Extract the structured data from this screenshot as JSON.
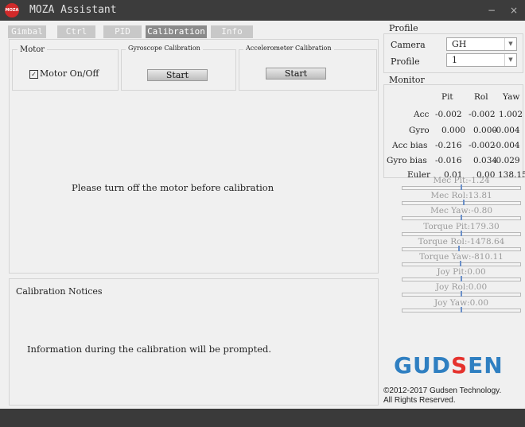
{
  "window": {
    "title": "MOZA Assistant",
    "logo_text": "MOZA",
    "minimize": "−",
    "close": "×"
  },
  "tabs": [
    {
      "label": "Gimbal"
    },
    {
      "label": "Ctrl"
    },
    {
      "label": "PID"
    },
    {
      "label": "Calibration"
    },
    {
      "label": "Info"
    }
  ],
  "active_tab": "Calibration",
  "motor": {
    "group_title": "Motor",
    "checkbox_label": "Motor On/Off",
    "checked": true
  },
  "gyro": {
    "group_title": "Gyroscope Calibration",
    "button": "Start"
  },
  "accel": {
    "group_title": "Accelerometer Calibration",
    "button": "Start"
  },
  "main_message": "Please turn off the motor before calibration",
  "notices": {
    "title": "Calibration Notices",
    "message": "Information during the calibration will be prompted."
  },
  "profile": {
    "title": "Profile",
    "camera_label": "Camera",
    "camera_value": "GH",
    "profile_label": "Profile",
    "profile_value": "1"
  },
  "monitor": {
    "title": "Monitor",
    "headers": [
      "Pit",
      "Rol",
      "Yaw"
    ],
    "rows": [
      {
        "label": "Acc",
        "values": [
          "-0.002",
          "-0.002",
          "1.002"
        ]
      },
      {
        "label": "Gyro",
        "values": [
          "0.000",
          "0.000",
          "-0.004"
        ]
      },
      {
        "label": "Acc bias",
        "values": [
          "-0.216",
          "-0.002",
          "-0.004"
        ]
      },
      {
        "label": "Gyro bias",
        "values": [
          "-0.016",
          "0.034",
          "-0.029"
        ]
      },
      {
        "label": "Euler",
        "values": [
          "0.01",
          "0.00",
          "138.15"
        ]
      }
    ]
  },
  "gauges": [
    {
      "label": "Mec Pit:-1.24",
      "level": 0.5
    },
    {
      "label": "Mec Rol:13.81",
      "level": 0.52
    },
    {
      "label": "Mec Yaw:-0.80",
      "level": 0.5
    },
    {
      "label": "Torque Pit:179.30",
      "level": 0.5
    },
    {
      "label": "Torque Rol:-1478.64",
      "level": 0.48
    },
    {
      "label": "Torque Yaw:-810.11",
      "level": 0.49
    },
    {
      "label": "Joy Pit:0.00",
      "level": 0.5
    },
    {
      "label": "Joy Rol:0.00",
      "level": 0.5
    },
    {
      "label": "Joy Yaw:0.00",
      "level": 0.5
    }
  ],
  "brand": {
    "logo_blue": "GUD",
    "logo_red": "S",
    "logo_blue2": "EN"
  },
  "copyright": {
    "line1": "©2012-2017 Gudsen Technology.",
    "line2": "All Rights Reserved."
  },
  "colors": {
    "titlebar": "#3c3c3c",
    "brand_blue": "#2f7fc1",
    "brand_red": "#e5322d"
  }
}
